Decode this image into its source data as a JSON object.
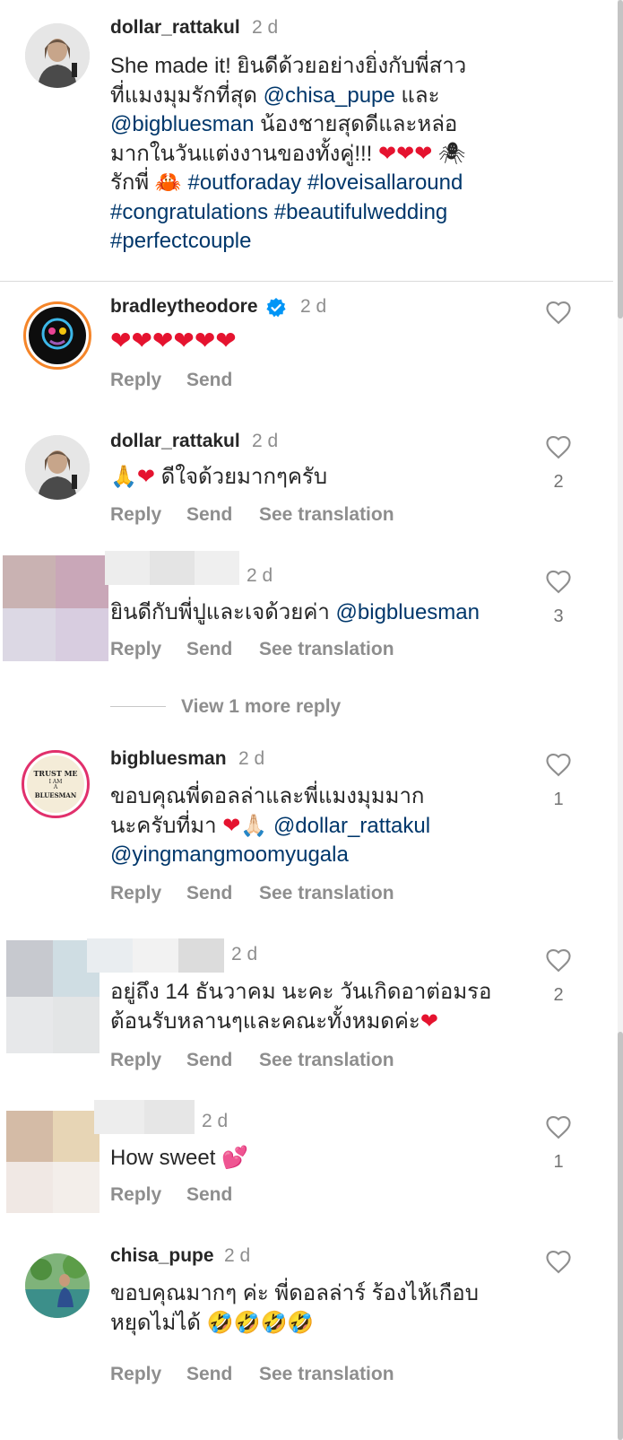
{
  "comments": [
    {
      "username": "dollar_rattakul",
      "time": "2 d",
      "lines": [
        "She made it! ยินดีด้วยอย่างยิ่งกับพี่สาว",
        "ที่แมงมุมรักที่สุด ",
        "@chisa_pupe",
        " และ",
        "@bigbluesman",
        " น้องชายสุดดีและหล่อ",
        "มากในวันแต่งงานของทั้งคู่!!! ",
        "❤❤❤",
        " 🕷",
        "รักพี่ 🦀 ",
        "#outforaday #loveisallaround",
        "#congratulations #beautifulwedding",
        "#perfectcouple"
      ]
    },
    {
      "username": "bradleytheodore",
      "time": "2 d",
      "verified": true,
      "text": "❤❤❤❤❤❤",
      "reply": "Reply",
      "send": "Send"
    },
    {
      "username": "dollar_rattakul",
      "time": "2 d",
      "text_emoji": "🙏",
      "text_heart": "❤",
      "text": " ดีใจด้วยมากๆครับ",
      "reply": "Reply",
      "send": "Send",
      "translate": "See translation",
      "likes": "2"
    },
    {
      "time": "2 d",
      "text": "ยินดีกับพี่ปูและเจด้วยค่า ",
      "mention": "@bigbluesman",
      "reply": "Reply",
      "send": "Send",
      "translate": "See translation",
      "likes": "3"
    },
    {
      "view_more": "View 1 more reply"
    },
    {
      "username": "bigbluesman",
      "time": "2 d",
      "line1": "ขอบคุณพี่ดอลล่าและพี่แมงมุมมาก",
      "line2_text": "นะครับที่มา ",
      "line2_heart": "❤",
      "line2_emoji": "🙏🏻",
      "line2_mention": "@dollar_rattakul",
      "line3_mention": "@yingmangmoomyugala",
      "reply": "Reply",
      "send": "Send",
      "translate": "See translation",
      "likes": "1",
      "avatar_text": [
        "TRUST ME",
        "I AM",
        "A",
        "BLUESMAN"
      ]
    },
    {
      "time": "2 d",
      "line1": "อยู่ถึง 14 ธันวาคม นะคะ วันเกิดอาต่อมรอ",
      "line2": "ต้อนรับหลานๆและคณะทั้งหมดค่ะ",
      "line2_heart": "❤",
      "reply": "Reply",
      "send": "Send",
      "translate": "See translation",
      "likes": "2"
    },
    {
      "time": "2 d",
      "text": "How sweet ",
      "emoji": "💕",
      "reply": "Reply",
      "send": "Send",
      "likes": "1"
    },
    {
      "username": "chisa_pupe",
      "time": "2 d",
      "line1": "ขอบคุณมากๆ ค่ะ พี่ดอลล่าร์ ร้องไห้เกือบ",
      "line2": "หยุดไม่ได้ ",
      "line2_emoji": "🤣🤣🤣🤣",
      "reply": "Reply",
      "send": "Send",
      "translate": "See translation"
    }
  ],
  "icons": {
    "like": "heart-outline-icon",
    "verified": "verified-badge-icon"
  },
  "colors": {
    "link": "#00376b",
    "secondary": "#8e8e8e",
    "heart": "#e5132f",
    "verified": "#0095f6",
    "story_ring": "#dd2a7b"
  }
}
